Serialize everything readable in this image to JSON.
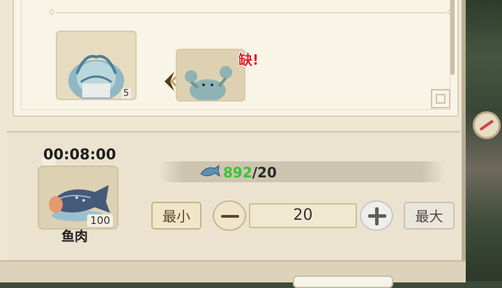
{
  "recipe": {
    "ingredients": [
      {
        "name": "shrimp-ingredient",
        "count": "5"
      },
      {
        "name": "crab-ingredient",
        "status": "缺!"
      }
    ]
  },
  "production": {
    "timer": "00:08:00",
    "product": {
      "name": "鱼肉",
      "quantity": "100"
    },
    "cost": {
      "have": "892",
      "need": "/20"
    },
    "buttons": {
      "min_label": "最小",
      "max_label": "最大"
    },
    "quantity_value": "20"
  },
  "colors": {
    "have_green": "#37c535",
    "missing_red": "#dd2222"
  }
}
